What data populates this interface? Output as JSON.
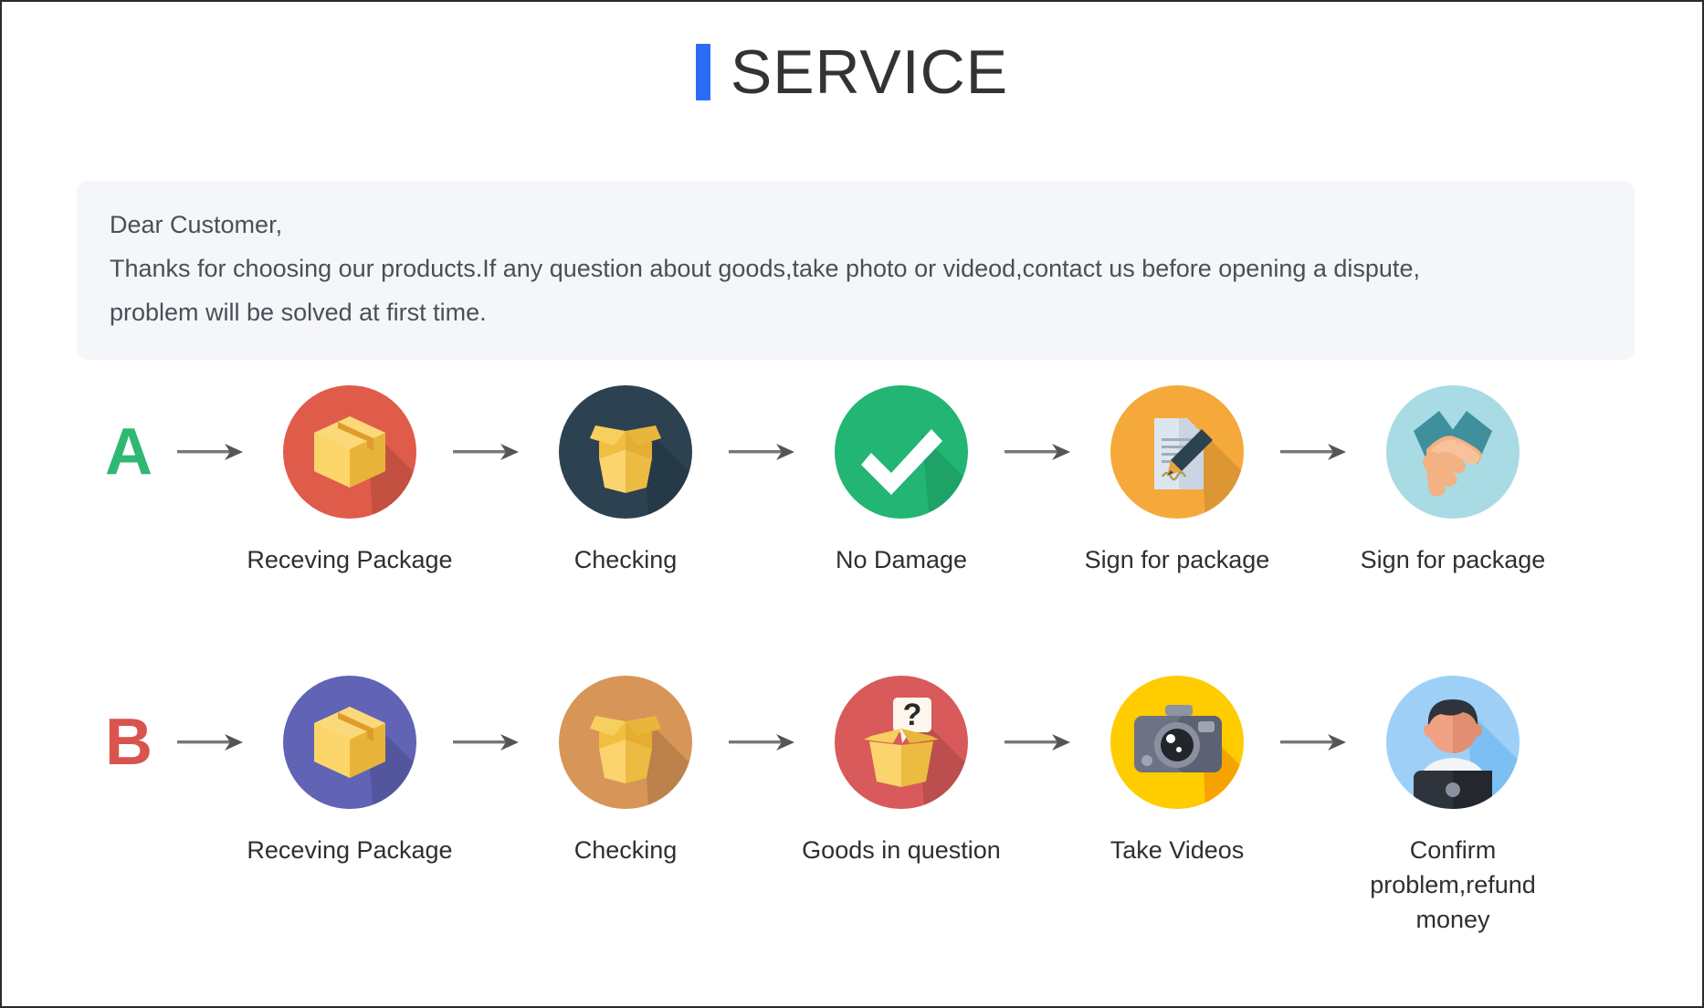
{
  "header": {
    "title": "SERVICE",
    "accent_color": "#2a6cf5"
  },
  "notice": {
    "background": "#f5f6fa",
    "lines": [
      "Dear Customer,",
      "Thanks for choosing our products.If any question about goods,take photo or videod,contact us before opening a dispute,",
      "problem will be solved at first time."
    ]
  },
  "flows": [
    {
      "badge": "A",
      "badge_color": "#2eb872",
      "steps": [
        {
          "label": "Receving Package",
          "icon": "closed-box-icon",
          "circle_color": "#e05c4a"
        },
        {
          "label": "Checking",
          "icon": "open-box-icon",
          "circle_color": "#2c4251"
        },
        {
          "label": "No Damage",
          "icon": "check-mark-icon",
          "circle_color": "#22b573"
        },
        {
          "label": "Sign for package",
          "icon": "signature-document-icon",
          "circle_color": "#f5a93a"
        },
        {
          "label": "Sign for package",
          "icon": "handshake-icon",
          "circle_color": "#a8dbe4"
        }
      ]
    },
    {
      "badge": "B",
      "badge_color": "#d9534f",
      "steps": [
        {
          "label": "Receving Package",
          "icon": "closed-box-icon",
          "circle_color": "#6163b5"
        },
        {
          "label": "Checking",
          "icon": "open-box-icon",
          "circle_color": "#d79657"
        },
        {
          "label": "Goods in question",
          "icon": "question-box-icon",
          "circle_color": "#d85a5a"
        },
        {
          "label": "Take Videos",
          "icon": "camera-icon",
          "circle_color": "#ffcc00"
        },
        {
          "label": "Confirm problem,refund money",
          "icon": "support-person-icon",
          "circle_color": "#9ed0f7"
        }
      ]
    }
  ],
  "arrow": {
    "name": "right-arrow-icon",
    "color": "#555555"
  }
}
